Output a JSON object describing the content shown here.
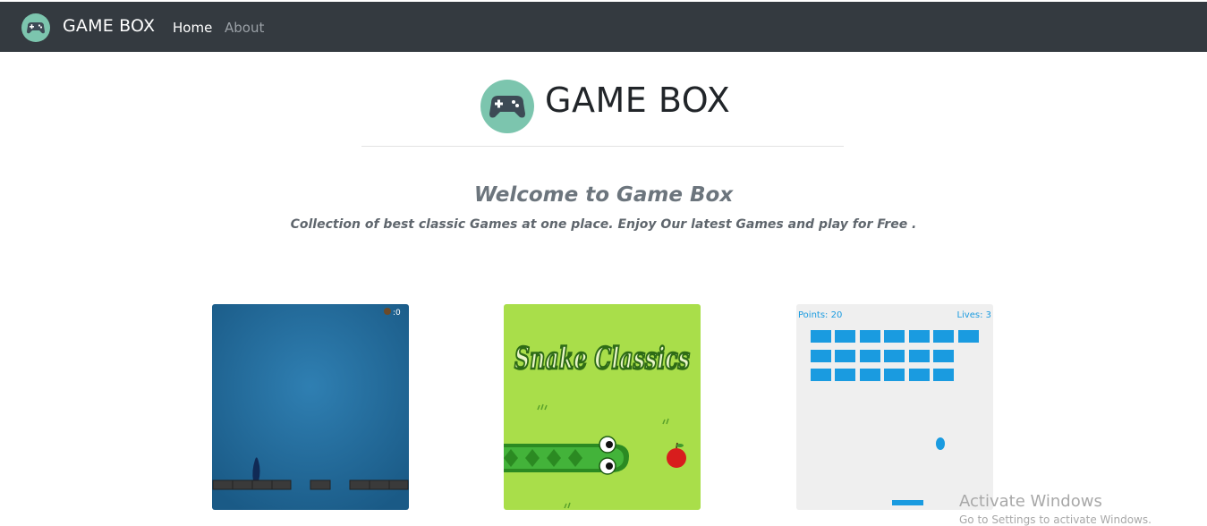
{
  "navbar": {
    "brand": "GAME BOX",
    "links": [
      {
        "label": "Home",
        "active": true
      },
      {
        "label": "About",
        "active": false
      }
    ],
    "logo_icon": "gamepad-icon",
    "bg_color": "#343a40"
  },
  "hero": {
    "title": "GAME BOX",
    "logo_icon": "gamepad-icon",
    "logo_color": "#7cc5ae"
  },
  "welcome": {
    "heading": "Welcome to Game Box",
    "tagline": "Collection of best classic Games at one place. Enjoy Our latest Games and play for Free ."
  },
  "games": [
    {
      "name": "platform-game-thumbnail",
      "hud_score": ":0"
    },
    {
      "name": "snake-classics-thumbnail",
      "title": "Snake Classics"
    },
    {
      "name": "brick-breaker-thumbnail",
      "points": "Points: 20",
      "lives": "Lives: 3"
    }
  ],
  "watermark": {
    "line1": "Activate Windows",
    "line2": "Go to Settings to activate Windows."
  }
}
